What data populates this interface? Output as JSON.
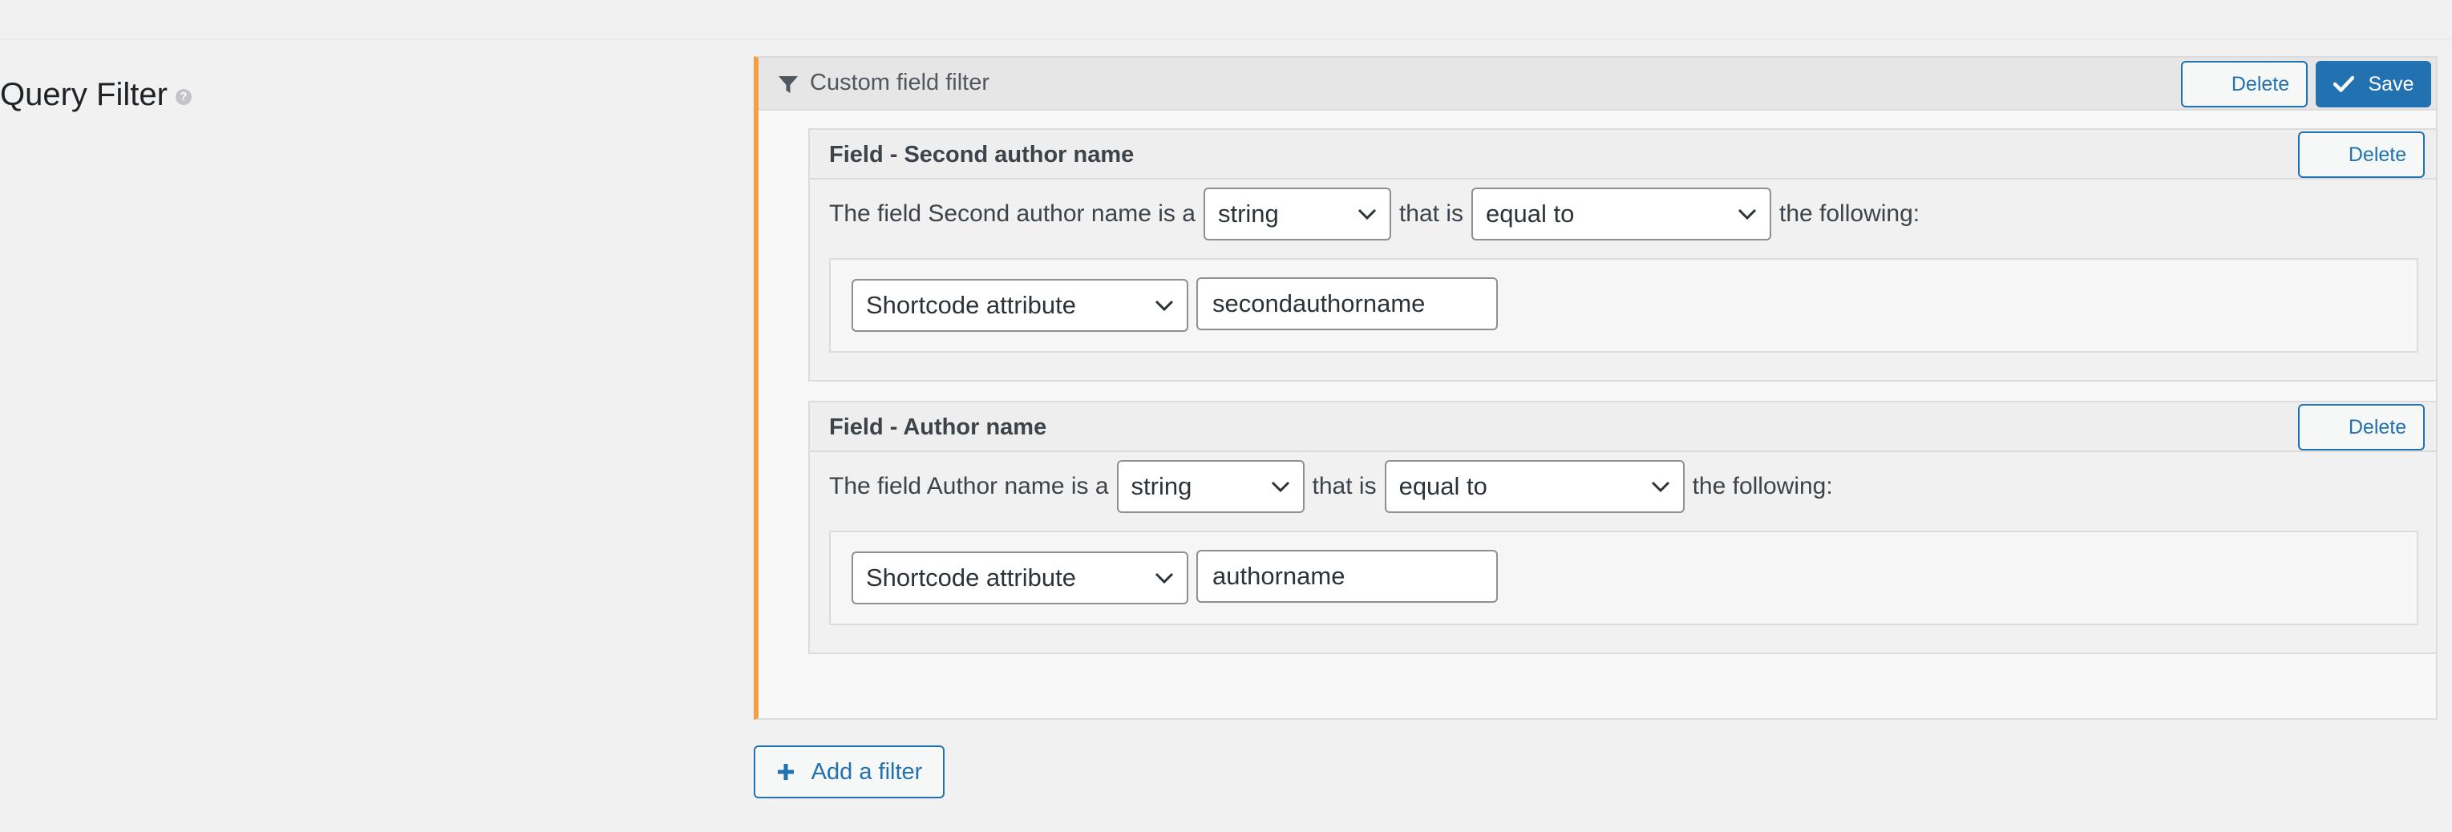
{
  "section": {
    "title": "Query Filter",
    "help_icon": "question-circle-icon"
  },
  "panel": {
    "title": "Custom field filter",
    "filter_icon": "funnel-icon",
    "delete_label": "Delete",
    "save_label": "Save",
    "save_icon": "checkmark-icon"
  },
  "fields": [
    {
      "title": "Field - Second author name",
      "delete_label": "Delete",
      "prefix": "The field Second author name is a",
      "type_value": "string",
      "middle": "that is",
      "comparison_value": "equal to",
      "suffix": "the following:",
      "source_value": "Shortcode attribute",
      "input_value": "secondauthorname"
    },
    {
      "title": "Field - Author name",
      "delete_label": "Delete",
      "prefix": "The field Author name is a",
      "type_value": "string",
      "middle": "that is",
      "comparison_value": "equal to",
      "suffix": "the following:",
      "source_value": "Shortcode attribute",
      "input_value": "authorname"
    }
  ],
  "add_filter": {
    "label": "Add a filter",
    "icon": "plus-icon"
  },
  "colors": {
    "accent": "#2271b1",
    "panel_border": "#f0a040",
    "background": "#f1f1f1"
  }
}
